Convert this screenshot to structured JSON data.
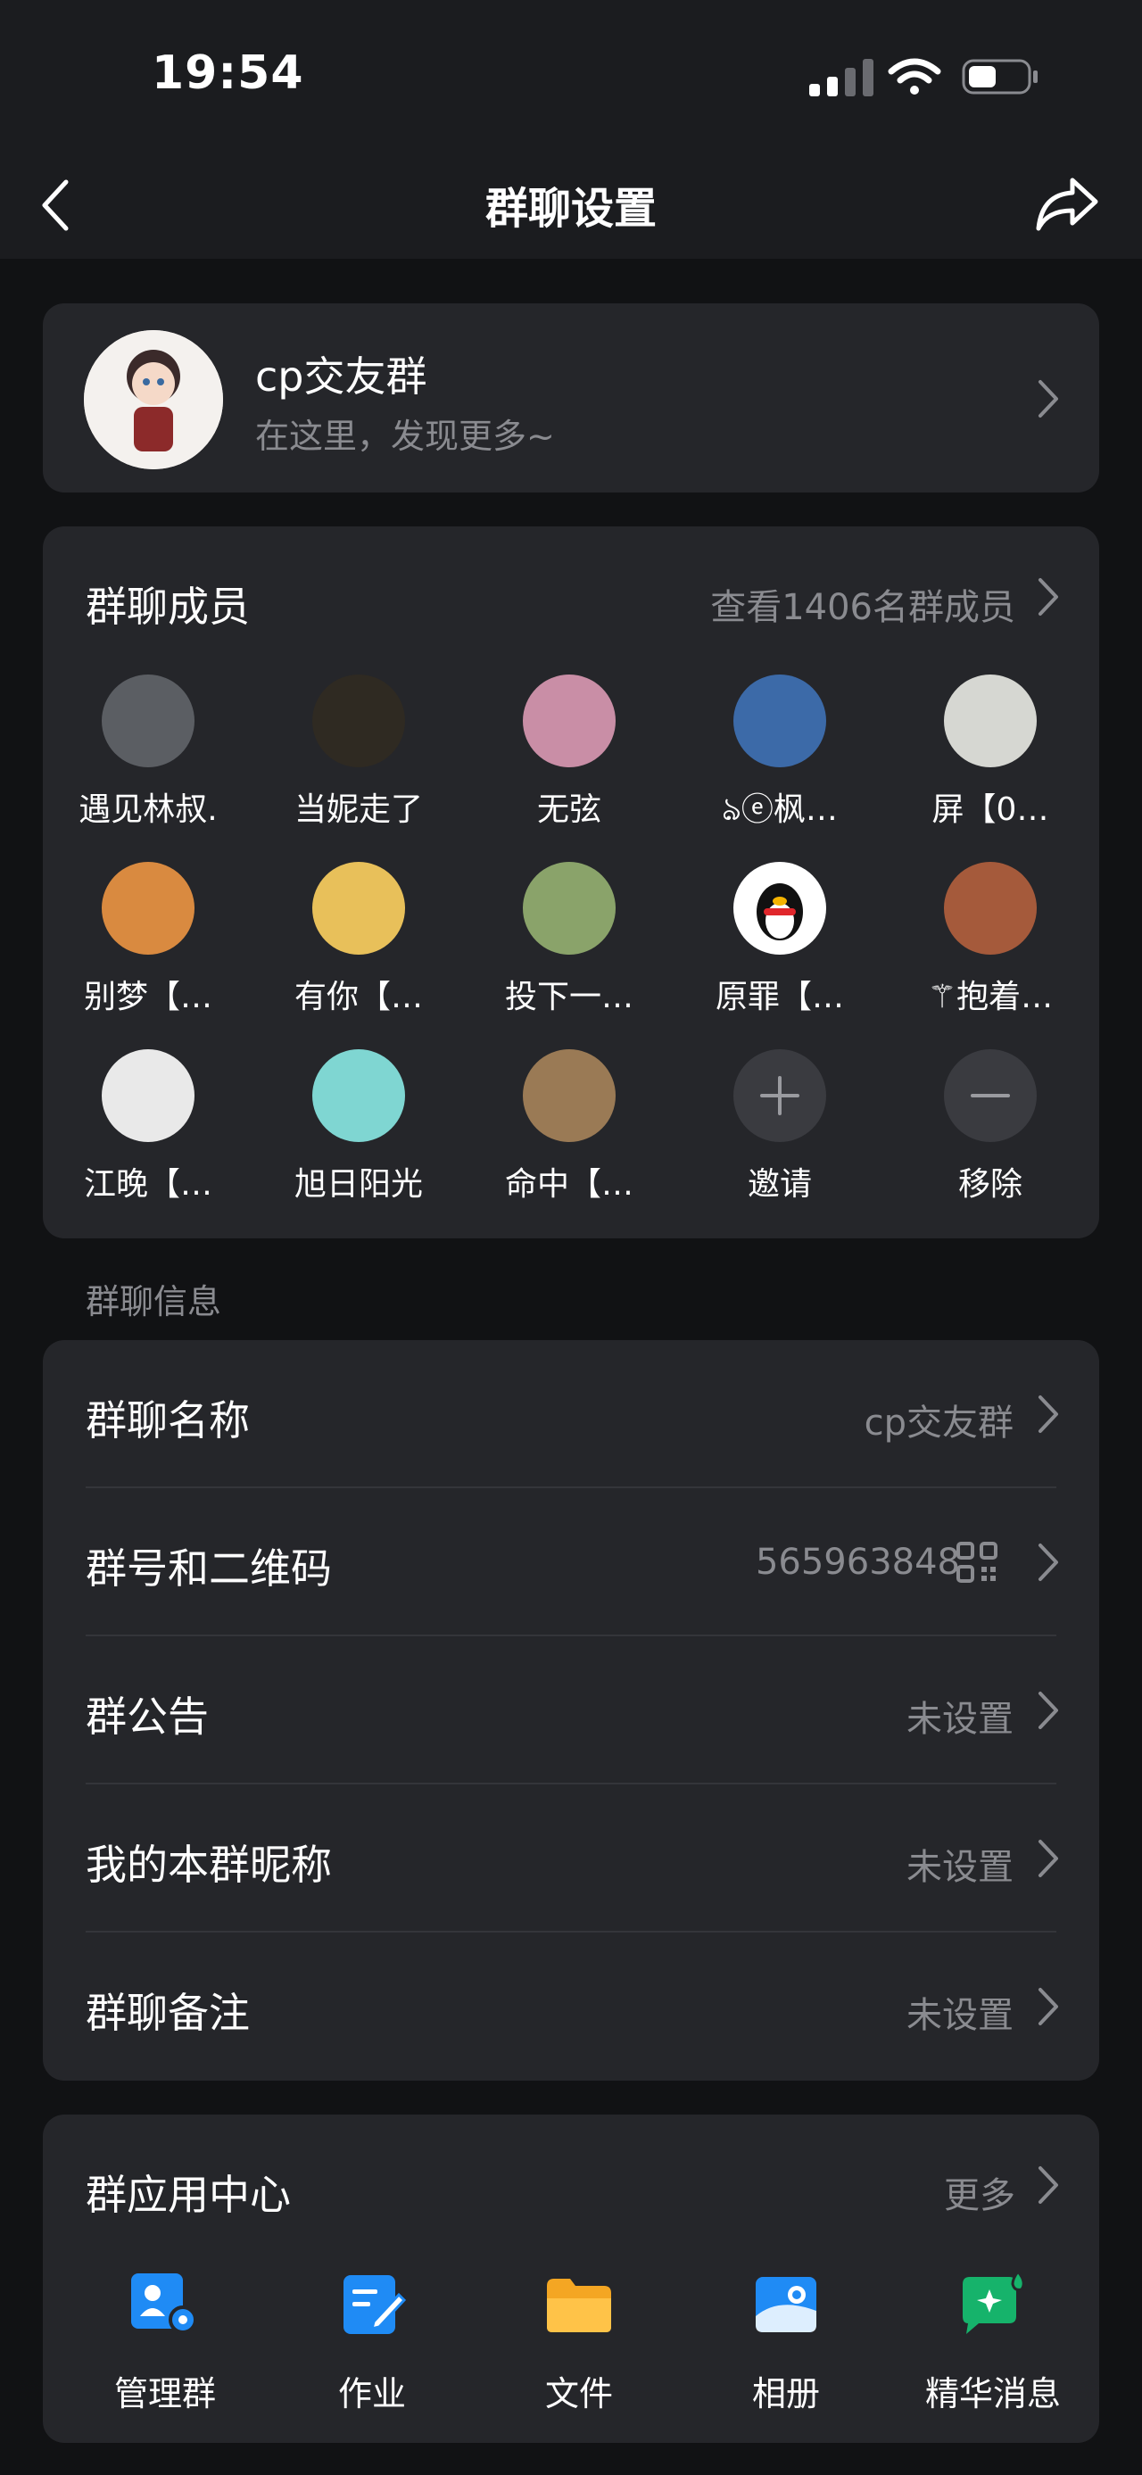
{
  "status_bar": {
    "time": "19:54"
  },
  "nav": {
    "title": "群聊设置"
  },
  "group": {
    "name": "cp交友群",
    "subtitle": "在这里，发现更多~"
  },
  "members": {
    "title": "群聊成员",
    "view_all": "查看1406名群成员",
    "list": [
      {
        "name": "遇见林叔.",
        "color": "#5b5e63"
      },
      {
        "name": "当妮走了",
        "color": "#2f2a22"
      },
      {
        "name": "无弦",
        "color": "#c98ea6"
      },
      {
        "name": "ঌⓔ枫…",
        "color": "#3c6aa8"
      },
      {
        "name": "屏【0…",
        "color": "#d6d7d2"
      },
      {
        "name": "别梦【…",
        "color": "#d98a40"
      },
      {
        "name": "有你【…",
        "color": "#e8c05a"
      },
      {
        "name": "投下一…",
        "color": "#8aa36a"
      },
      {
        "name": "原罪【…",
        "color": "#ffffff"
      },
      {
        "name": "⚚抱着…",
        "color": "#a55a3b"
      },
      {
        "name": "江晚【…",
        "color": "#e9e9e9"
      },
      {
        "name": "旭日阳光",
        "color": "#7fd6d2"
      },
      {
        "name": "命中【…",
        "color": "#9a7a55"
      }
    ],
    "invite_label": "邀请",
    "remove_label": "移除"
  },
  "info": {
    "section_label": "群聊信息",
    "rows": [
      {
        "label": "群聊名称",
        "value": "cp交友群"
      },
      {
        "label": "群号和二维码",
        "value": "565963848"
      },
      {
        "label": "群公告",
        "value": "未设置"
      },
      {
        "label": "我的本群昵称",
        "value": "未设置"
      },
      {
        "label": "群聊备注",
        "value": "未设置"
      }
    ]
  },
  "apps": {
    "title": "群应用中心",
    "more": "更多",
    "items": [
      {
        "label": "管理群",
        "icon": "manage-group-icon"
      },
      {
        "label": "作业",
        "icon": "homework-icon"
      },
      {
        "label": "文件",
        "icon": "folder-icon"
      },
      {
        "label": "相册",
        "icon": "album-icon"
      },
      {
        "label": "精华消息",
        "icon": "essence-message-icon"
      }
    ]
  },
  "colors": {
    "background": "#111214",
    "card": "#25262a",
    "accent_blue": "#1f8bf5",
    "secondary_text": "#8a8b90"
  }
}
